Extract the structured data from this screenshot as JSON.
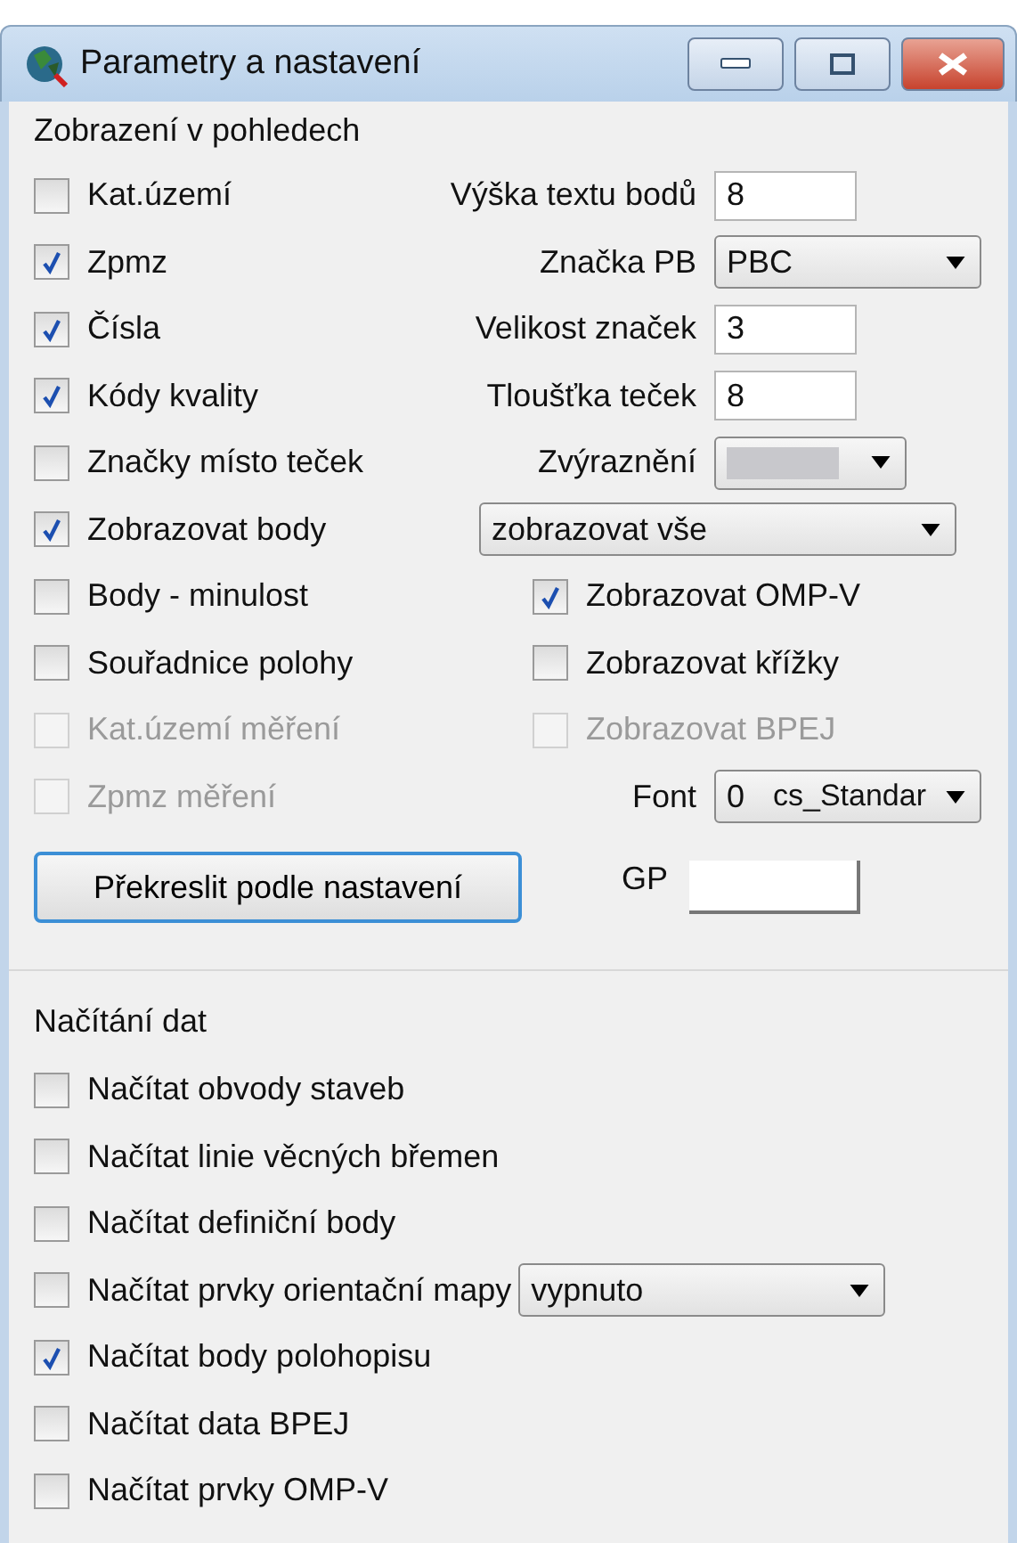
{
  "window": {
    "title": "Parametry a nastavení"
  },
  "display": {
    "title": "Zobrazení v pohledech",
    "rows": [
      {
        "left": {
          "label": "Kat.území",
          "checked": false,
          "disabled": false
        },
        "right": {
          "kind": "field",
          "label": "Výška textu bodů",
          "value": "8"
        }
      },
      {
        "left": {
          "label": "Zpmz",
          "checked": true,
          "disabled": false
        },
        "right": {
          "kind": "dropdown",
          "label": "Značka PB",
          "value": "PBC"
        }
      },
      {
        "left": {
          "label": "Čísla",
          "checked": true,
          "disabled": false
        },
        "right": {
          "kind": "field",
          "label": "Velikost značek",
          "value": "3"
        }
      },
      {
        "left": {
          "label": "Kódy kvality",
          "checked": true,
          "disabled": false
        },
        "right": {
          "kind": "field",
          "label": "Tloušťka teček",
          "value": "8"
        }
      },
      {
        "left": {
          "label": "Značky místo teček",
          "checked": false,
          "disabled": false
        },
        "right": {
          "kind": "color",
          "label": "Zvýraznění",
          "color": "#c8c8cc"
        }
      },
      {
        "left": {
          "label": "Zobrazovat body",
          "checked": true,
          "disabled": false
        },
        "right": {
          "kind": "wide",
          "value": "zobrazovat vše"
        }
      },
      {
        "left": {
          "label": "Body - minulost",
          "checked": false,
          "disabled": false
        },
        "right": {
          "kind": "checkbox",
          "label": "Zobrazovat OMP-V",
          "checked": true,
          "disabled": false
        }
      },
      {
        "left": {
          "label": "Souřadnice polohy",
          "checked": false,
          "disabled": false
        },
        "right": {
          "kind": "checkbox",
          "label": "Zobrazovat křížky",
          "checked": false,
          "disabled": false
        }
      },
      {
        "left": {
          "label": "Kat.území měření",
          "checked": false,
          "disabled": true
        },
        "right": {
          "kind": "checkbox",
          "label": "Zobrazovat BPEJ",
          "checked": false,
          "disabled": true
        }
      },
      {
        "left": {
          "label": "Zpmz měření",
          "checked": false,
          "disabled": true
        },
        "right": {
          "kind": "font",
          "label": "Font",
          "number": "0",
          "value": "cs_Standar"
        }
      }
    ],
    "button": "Překreslit podle nastavení",
    "gp": {
      "label": "GP"
    }
  },
  "load": {
    "title": "Načítání dat",
    "items": [
      {
        "label": "Načítat obvody staveb",
        "checked": false
      },
      {
        "label": "Načítat linie věcných břemen",
        "checked": false
      },
      {
        "label": "Načítat definiční body",
        "checked": false
      },
      {
        "label": "Načítat prvky orientační mapy",
        "checked": false,
        "dropdown": "vypnuto"
      },
      {
        "label": "Načítat body polohopisu",
        "checked": true
      },
      {
        "label": "Načítat data BPEJ",
        "checked": false
      },
      {
        "label": "Načítat prvky OMP-V",
        "checked": false
      }
    ]
  }
}
